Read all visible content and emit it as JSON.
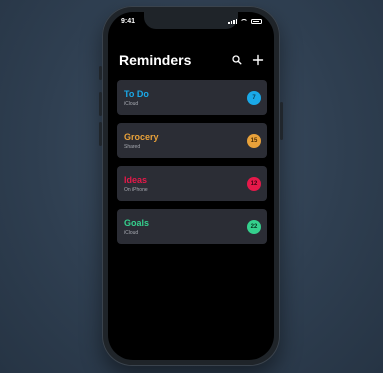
{
  "status": {
    "time": "9:41"
  },
  "header": {
    "title": "Reminders"
  },
  "lists": [
    {
      "name": "To Do",
      "subtitle": "iCloud",
      "count": "7",
      "color": "#1aa9e8",
      "count_text": "#0b3a52"
    },
    {
      "name": "Grocery",
      "subtitle": "Shared",
      "count": "15",
      "color": "#e8a13a",
      "count_text": "#4a2c05"
    },
    {
      "name": "Ideas",
      "subtitle": "On iPhone",
      "count": "12",
      "color": "#e5194a",
      "count_text": "#3d0212"
    },
    {
      "name": "Goals",
      "subtitle": "iCloud",
      "count": "22",
      "color": "#35d08d",
      "count_text": "#05361f"
    }
  ],
  "icons": {
    "search": "search-icon",
    "add": "plus-icon"
  }
}
